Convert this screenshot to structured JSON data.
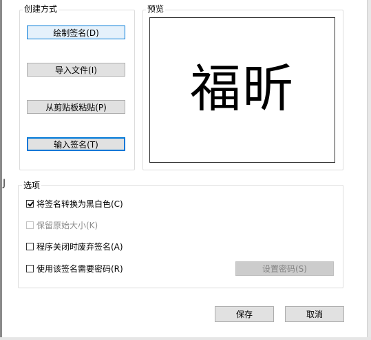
{
  "background_fragment": "J",
  "create_group": {
    "title": "创建方式",
    "buttons": {
      "draw": "绘制签名(D)",
      "import": "导入文件(I)",
      "paste": "从剪贴板粘贴(P)",
      "type": "输入签名(T)"
    }
  },
  "preview_group": {
    "title": "预览",
    "signature_text": "福昕"
  },
  "options_group": {
    "title": "选项",
    "convert_bw": {
      "label": "将签名转换为黑白色(C)",
      "checked": true
    },
    "keep_size": {
      "label": "保留原始大小(K)",
      "checked": false,
      "disabled": true
    },
    "discard_on_close": {
      "label": "程序关闭时废弃签名(A)",
      "checked": false
    },
    "require_password": {
      "label": "使用该签名需要密码(R)",
      "checked": false
    },
    "set_password_button": "设置密码(S)"
  },
  "footer": {
    "save": "保存",
    "cancel": "取消"
  },
  "colors": {
    "accent": "#0078d7",
    "button_bg": "#e1e1e1",
    "group_border": "#dcdcdc"
  }
}
